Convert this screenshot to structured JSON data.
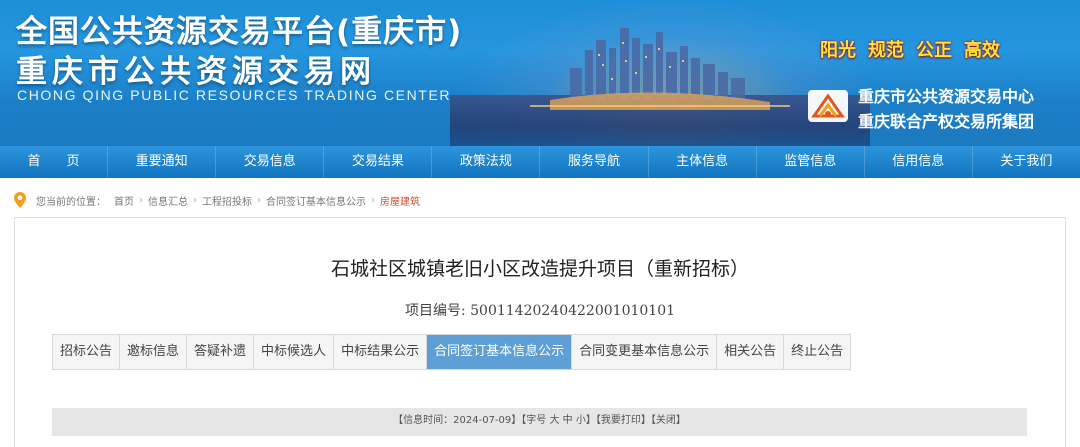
{
  "header": {
    "title_line1": "全国公共资源交易平台(重庆市)",
    "title_line2": "重庆市公共资源交易网",
    "title_en": "CHONG QING PUBLIC RESOURCES TRADING CENTER",
    "slogans": [
      "阳光",
      "规范",
      "公正",
      "高效"
    ],
    "org_line1": "重庆市公共资源交易中心",
    "org_line2": "重庆联合产权交易所集团"
  },
  "nav": {
    "items": [
      "首　　页",
      "重要通知",
      "交易信息",
      "交易结果",
      "政策法规",
      "服务导航",
      "主体信息",
      "监管信息",
      "信用信息",
      "关于我们"
    ]
  },
  "breadcrumb": {
    "prefix": "您当前的位置：",
    "items": [
      "首页",
      "信息汇总",
      "工程招投标",
      "合同签订基本信息公示",
      "房屋建筑"
    ],
    "separator": "›"
  },
  "project": {
    "title": "石城社区城镇老旧小区改造提升项目（重新招标）",
    "number_label": "项目编号:",
    "number": "500114202404220010101​01"
  },
  "tabs": {
    "items": [
      "招标公告",
      "邀标信息",
      "答疑补遗",
      "中标候选人",
      "中标结果公示",
      "合同签订基本信息公示",
      "合同变更基本信息公示",
      "相关公告",
      "终止公告"
    ],
    "active_index": 5
  },
  "info_bar": {
    "time_label": "【信息时间：",
    "time_value": "2024-07-09",
    "time_close": "】",
    "font_label": "【字号",
    "font_big": "大",
    "font_mid": "中",
    "font_small": "小",
    "font_close": "】",
    "print": "【我要打印】",
    "close": "【关闭】"
  },
  "colors": {
    "banner_blue": "#1d8ed8",
    "nav_blue": "#1273be",
    "active_tab": "#5e9fd5",
    "slogan_yellow": "#ffe23c",
    "crumb_current": "#d24b2a",
    "pin_orange": "#f39c1e"
  },
  "icons": {
    "location": "location-pin-icon",
    "org_logo": "org-logo-icon"
  }
}
